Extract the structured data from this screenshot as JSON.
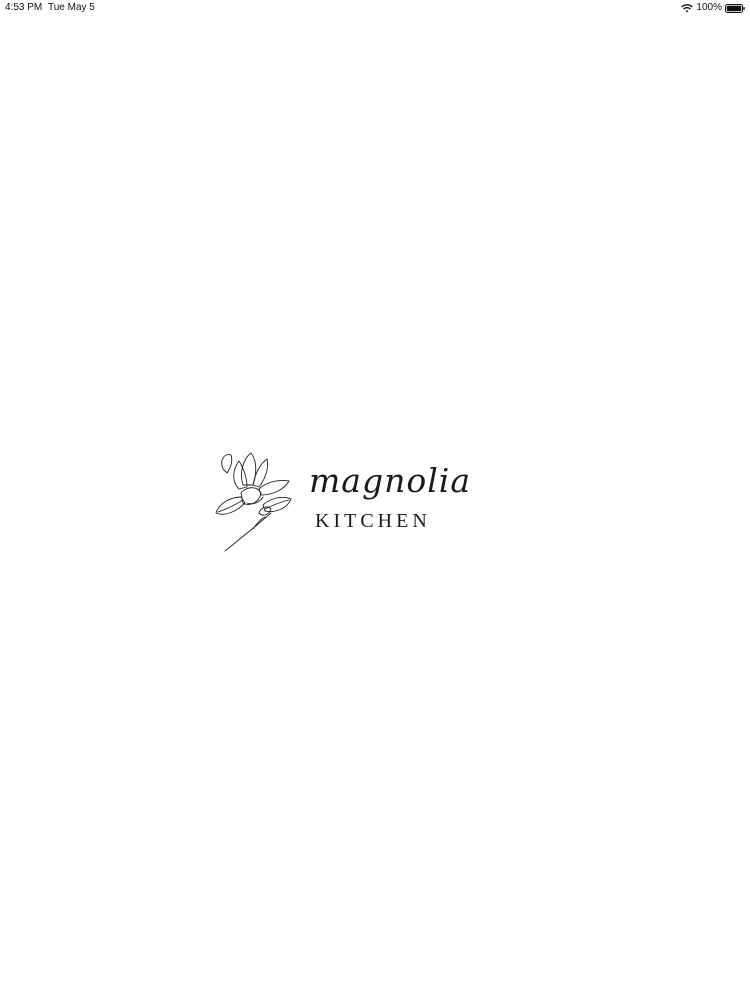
{
  "status_bar": {
    "time": "4:53 PM",
    "date": "Tue May 5",
    "battery_percent": "100%",
    "battery_level": 1.0
  },
  "splash": {
    "logo": {
      "brand_name": "magnolia",
      "brand_subtitle": "KITCHEN",
      "icon": "magnolia-flower-icon"
    }
  }
}
